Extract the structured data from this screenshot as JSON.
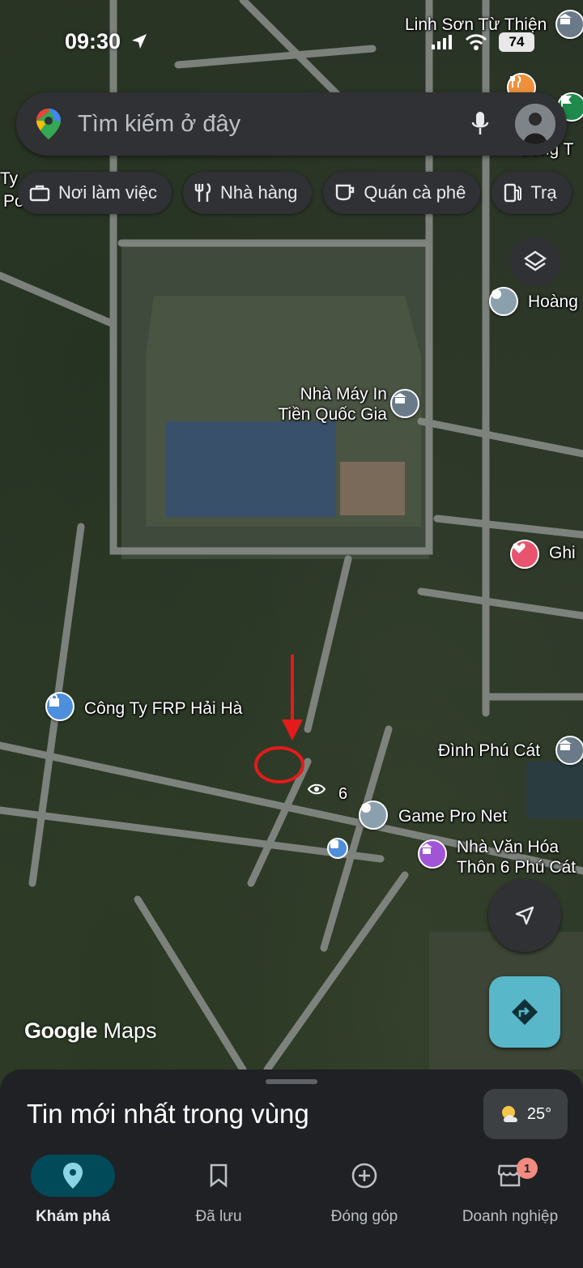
{
  "status_bar": {
    "time": "09:30",
    "battery": "74"
  },
  "search": {
    "placeholder": "Tìm kiếm ở đây"
  },
  "chips": [
    {
      "label": "Nơi làm việc",
      "icon": "briefcase-icon"
    },
    {
      "label": "Nhà hàng",
      "icon": "fork-knife-icon"
    },
    {
      "label": "Quán cà phê",
      "icon": "coffee-icon"
    },
    {
      "label": "Trạ",
      "icon": "gas-station-icon"
    }
  ],
  "map": {
    "labels": {
      "top_right": "Linh Sơn Từ Thiện",
      "cong_ty_partial": "Công T",
      "left_partial_1": "Ty",
      "left_partial_2": "Po",
      "ty_partial": "Ty",
      "hoang": "Hoàng",
      "printing_factory_line1": "Nhà Máy In",
      "printing_factory_line2": "Tiền Quốc Gia",
      "ghi": "Ghi",
      "frp": "Công Ty FRP Hải Hà",
      "dinh_phu_cat": "Đình Phú Cát",
      "six": "6",
      "game_pro_net": "Game Pro Net",
      "cultural_house_line1": "Nhà Văn Hóa",
      "cultural_house_line2": "Thôn 6 Phú Cát"
    },
    "logo_google": "Google",
    "logo_maps": "Maps",
    "annotation_color": "#e31b1b"
  },
  "sheet": {
    "title": "Tin mới nhất trong vùng",
    "temperature": "25°"
  },
  "nav": [
    {
      "label": "Khám phá",
      "active": true
    },
    {
      "label": "Đã lưu",
      "active": false
    },
    {
      "label": "Đóng góp",
      "active": false
    },
    {
      "label": "Doanh nghiệp",
      "active": false,
      "badge": "1"
    }
  ]
}
